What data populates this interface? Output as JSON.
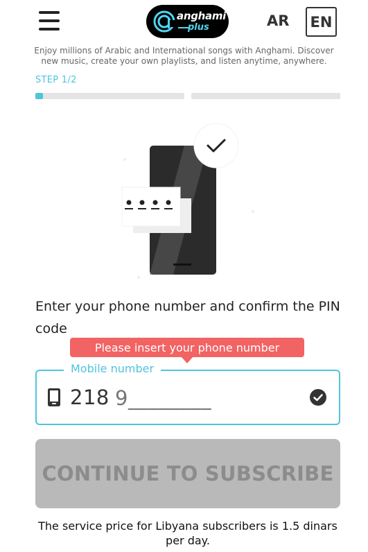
{
  "header": {
    "logo_word": "anghami",
    "logo_sub": "plus",
    "lang_ar": "AR",
    "lang_en": "EN"
  },
  "intro_text": "Enjoy millions of Arabic and International songs with Anghami. Discover new music, create your own playlists, and listen anytime, anywhere.",
  "stepper": {
    "label": "STEP 1/2",
    "current_step": 1,
    "total_steps": 2,
    "step1_progress_fraction": 0.05,
    "step2_progress_fraction": 0
  },
  "illustration": {
    "pin_mask": "• • • •"
  },
  "form": {
    "prompt": "Enter your phone number and confirm the PIN code",
    "error_tooltip": "Please insert your phone number",
    "field_label": "Mobile number",
    "country_prefix": "218",
    "phone_value": "9________",
    "phone_icon": "mobile-phone-icon",
    "valid_icon": "check-circle-icon"
  },
  "cta": {
    "label": "CONTINUE TO SUBSCRIBE",
    "enabled": false
  },
  "footer_note": "The service price for Libyana subscribers is 1.5 dinars per day.",
  "colors": {
    "accent": "#4fc4dd",
    "error": "#f26363",
    "button_disabled_bg": "#b9b9b9",
    "button_disabled_text": "#8c8c8c"
  }
}
